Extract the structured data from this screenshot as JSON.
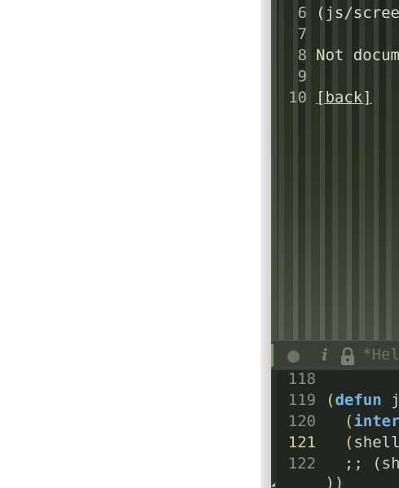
{
  "upper_window": {
    "lines": [
      {
        "num": "6",
        "text": "(js/scree"
      },
      {
        "num": "7",
        "text": ""
      },
      {
        "num": "8",
        "text": "Not docum"
      },
      {
        "num": "9",
        "text": ""
      },
      {
        "num": "10",
        "text": "[back]"
      }
    ]
  },
  "modeline": {
    "status_indicator": "modified-dot",
    "info_glyph": "i",
    "lock_icon": "lock-icon",
    "buffer_name": "*Hel"
  },
  "lower_window": {
    "current_line": "121",
    "lines": [
      {
        "num": "118",
        "text": ""
      },
      {
        "num": "119",
        "open": "(",
        "keyword": "defun",
        "rest": " j"
      },
      {
        "num": "120",
        "open": "  (",
        "keyword": "inter",
        "rest": ""
      },
      {
        "num": "121",
        "open": "  (",
        "keyword": "",
        "rest": "shell"
      },
      {
        "num": "122",
        "comment": "  ;; (sh"
      },
      {
        "num": "",
        "close": " ))"
      }
    ]
  },
  "colors": {
    "keyword": "#76b4e6",
    "comment": "#8db04a",
    "current_line_number": "#d8d59a",
    "active_indicator": "#6a9a5a"
  }
}
